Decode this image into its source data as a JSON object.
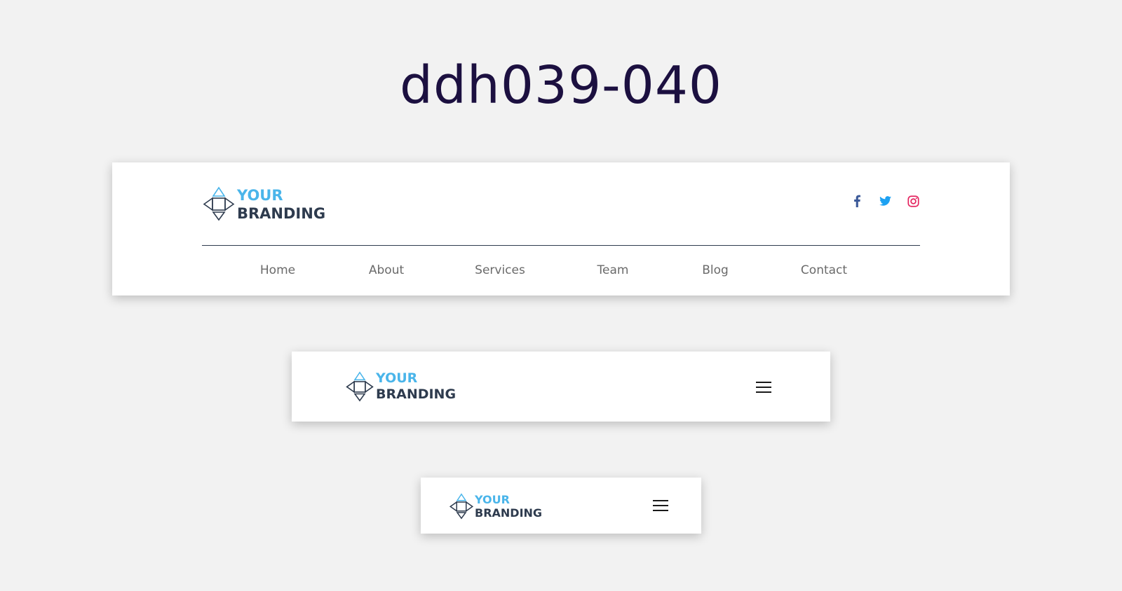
{
  "page": {
    "title": "ddh039-040"
  },
  "brand": {
    "line1": "YOUR",
    "line2": "BRANDING",
    "colors": {
      "accent": "#4ab5ea",
      "dark": "#2e3b4e"
    }
  },
  "social": [
    {
      "name": "facebook",
      "icon": "facebook-icon",
      "color": "#3b5998"
    },
    {
      "name": "twitter",
      "icon": "twitter-icon",
      "color": "#1da1f2"
    },
    {
      "name": "instagram",
      "icon": "instagram-icon",
      "color": "#e4245f"
    }
  ],
  "nav": {
    "items": [
      {
        "label": "Home"
      },
      {
        "label": "About"
      },
      {
        "label": "Services"
      },
      {
        "label": "Team"
      },
      {
        "label": "Blog"
      },
      {
        "label": "Contact"
      }
    ]
  },
  "menu": {
    "icon": "hamburger-menu-icon"
  }
}
